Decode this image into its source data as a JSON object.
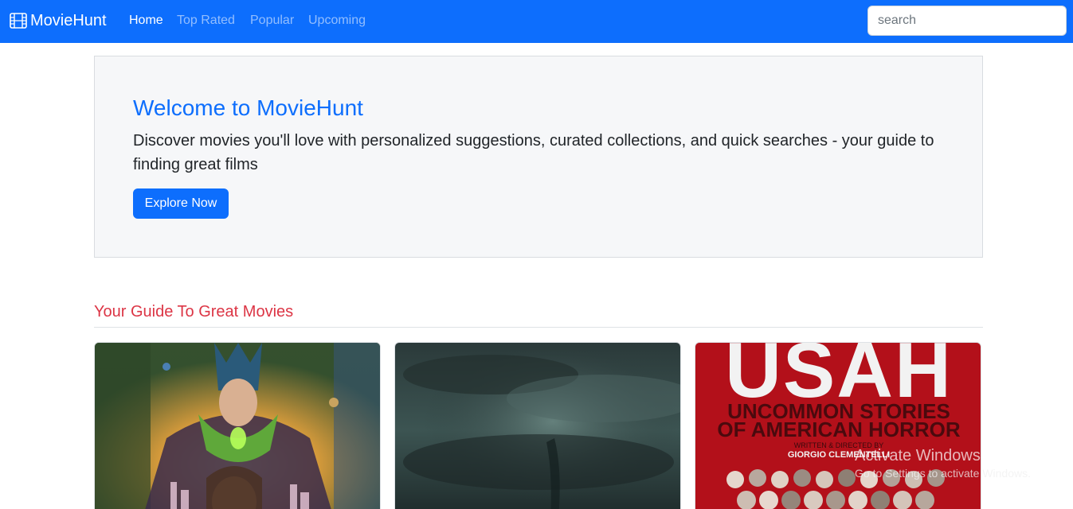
{
  "navbar": {
    "brand": {
      "icon": "film-icon",
      "text": "MovieHunt"
    },
    "links": [
      {
        "label": "Home",
        "active": true
      },
      {
        "label": "Top Rated",
        "active": false
      },
      {
        "label": "Popular",
        "active": false
      },
      {
        "label": "Upcoming",
        "active": false
      }
    ],
    "search": {
      "placeholder": "search",
      "value": ""
    },
    "color": "#0d6efd"
  },
  "hero": {
    "title": "Welcome to MovieHunt",
    "description": "Discover movies you'll love with personalized suggestions, curated collections, and quick searches - your guide to finding great films",
    "button_label": "Explore Now"
  },
  "section": {
    "title": "Your Guide To Great Movies",
    "title_color": "#dc3545"
  },
  "cards": [
    {
      "poster_text": []
    },
    {
      "poster_text": []
    },
    {
      "poster_text": [
        "USAH",
        "UNCOMMON STORIES",
        "OF AMERICAN HORROR",
        "WRITTEN & DIRECTED BY",
        "GIORGIO CLEMENTELLI"
      ]
    }
  ],
  "watermark": {
    "line1": "Activate Windows",
    "line2": "Go to Settings to activate Windows."
  }
}
